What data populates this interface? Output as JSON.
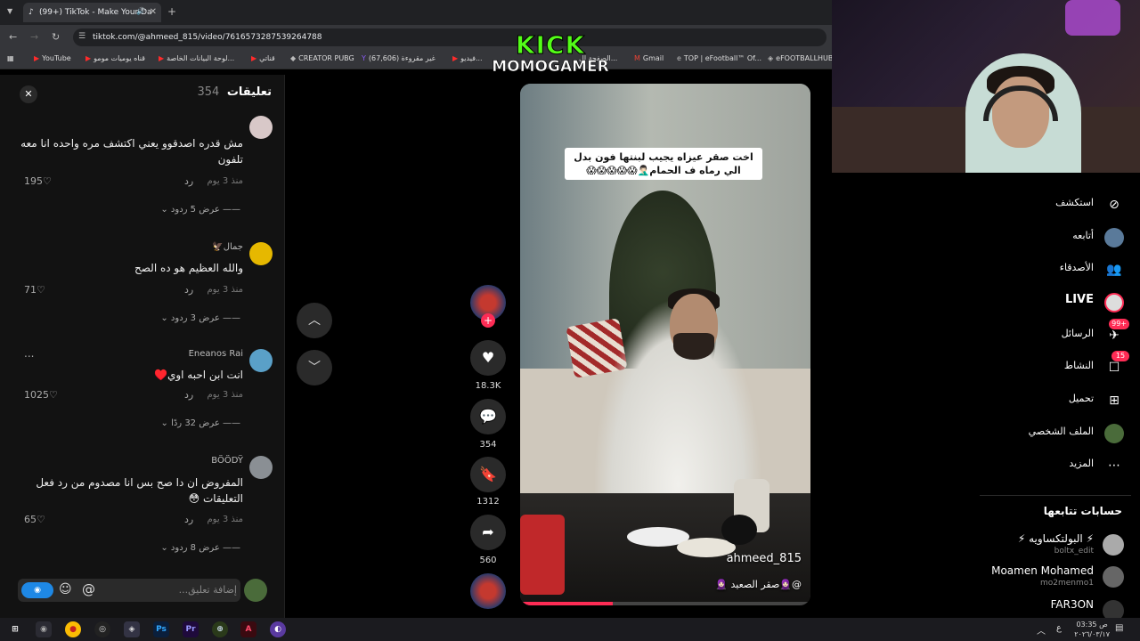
{
  "browser": {
    "tab_title": "(99+) TikTok - Make Your Da",
    "url": "tiktok.com/@ahmeed_815/video/7616573287539264788",
    "bookmarks": [
      "YouTube",
      "قناه يوميات مومو",
      "لوحة البيانات الخاصة...",
      "قناتي",
      "CREATOR PUBG",
      "غير مقروءة (67,606)",
      "فيديو...",
      "الصفحة ال...",
      "Gmail",
      "TOP | eFootball™ Of...",
      "eFOOTBALLHUB"
    ]
  },
  "overlay": {
    "kick_text": "KICK",
    "streamer_name": "MOMOGAMER"
  },
  "comments_panel": {
    "title": "تعليقات",
    "count": "354",
    "comments": [
      {
        "user": "",
        "text": "مش قدره اصدقوو يعني اكتشف مره واحده انا معه تلفون",
        "time": "منذ 3 يوم",
        "reply_label": "رد",
        "likes": "195",
        "more_replies": "عرض 5 ردود",
        "avatar_color": "#d8c8c8"
      },
      {
        "user": "جمال🦅",
        "text": "والله العظيم هو ده الصح",
        "time": "منذ 3 يوم",
        "reply_label": "رد",
        "likes": "71",
        "more_replies": "عرض 3 ردود",
        "avatar_color": "#e6b800"
      },
      {
        "user": "Eneanos Rai",
        "text": "انت ابن احبه اوي♥️",
        "time": "منذ 3 يوم",
        "reply_label": "رد",
        "likes": "1025",
        "more_replies": "عرض 32 ردًا",
        "avatar_color": "#5aa0c8"
      },
      {
        "user": "BÖÖDŸ",
        "text": "المفروض ان دا صح بس انا مصدوم من رد فعل التعليقات 😳",
        "time": "منذ 3 يوم",
        "reply_label": "رد",
        "likes": "65",
        "more_replies": "عرض 8 ردود",
        "avatar_color": "#8a8f94"
      }
    ],
    "input_placeholder": "إضافة تعليق...",
    "more_menu": "..."
  },
  "video": {
    "caption": "اخت صقر عيزاه يجيب لبنتها فون بدل الي رماه ف الحمام🤦🏻‍♂️😱😱😱😱😱",
    "author": "ahmeed_815",
    "description": "@🧕🏻صقر الصعيد 🧕🏻",
    "progress": 0.32
  },
  "actions": {
    "likes": "18.3K",
    "comments": "354",
    "saves": "1312",
    "shares": "560"
  },
  "sidebar": {
    "nav": [
      {
        "label": "استكشف",
        "icon": "compass-icon"
      },
      {
        "label": "أتابعه",
        "icon": "following-avatar-icon"
      },
      {
        "label": "الأصدقاء",
        "icon": "friends-icon"
      },
      {
        "label": "LIVE",
        "icon": "live-icon"
      },
      {
        "label": "الرسائل",
        "icon": "messages-icon",
        "badge": "99+"
      },
      {
        "label": "النشاط",
        "icon": "activity-icon",
        "badge": "15"
      },
      {
        "label": "تحميل",
        "icon": "upload-icon"
      },
      {
        "label": "الملف الشخصي",
        "icon": "profile-icon"
      },
      {
        "label": "المزيد",
        "icon": "more-icon"
      }
    ],
    "following_title": "حسابات تتابعها",
    "following": [
      {
        "name": "⚡ البولتكساويه ⚡",
        "handle": "boltx_edit"
      },
      {
        "name": "Moamen Mohamed",
        "handle": "mo2menmo1"
      },
      {
        "name": "FAR3ON",
        "handle": ""
      }
    ]
  },
  "taskbar": {
    "time": "03:35 ص",
    "date": "٢٠٢٦/٠٣/١٧",
    "lang": "ع"
  },
  "colors": {
    "accent": "#fe2c55",
    "kick_green": "#53fc18",
    "panel_bg": "#121212"
  }
}
